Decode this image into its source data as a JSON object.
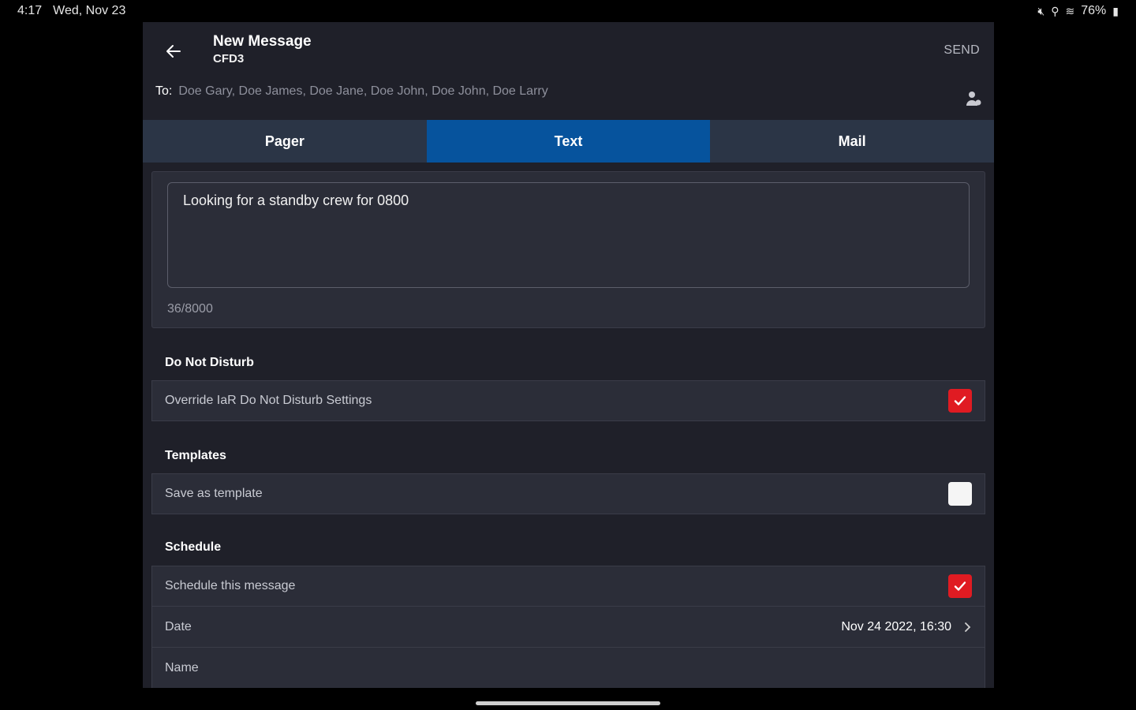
{
  "status_bar": {
    "time": "4:17",
    "date": "Wed, Nov 23",
    "icons": [
      "mute-icon",
      "location-icon",
      "wifi-icon"
    ],
    "battery": "76%"
  },
  "header": {
    "title": "New Message",
    "subtitle": "CFD3",
    "send_label": "SEND",
    "to_label": "To:",
    "recipients": "Doe Gary, Doe James, Doe Jane, Doe John, Doe John, Doe Larry"
  },
  "tabs": [
    {
      "label": "Pager",
      "active": false
    },
    {
      "label": "Text",
      "active": true
    },
    {
      "label": "Mail",
      "active": false
    }
  ],
  "compose": {
    "message": "Looking for a standby crew for 0800",
    "counter": "36/8000"
  },
  "dnd": {
    "section_title": "Do Not Disturb",
    "override_label": "Override IaR Do Not Disturb Settings",
    "override_checked": true
  },
  "templates": {
    "section_title": "Templates",
    "save_label": "Save as template",
    "save_checked": false
  },
  "schedule": {
    "section_title": "Schedule",
    "schedule_label": "Schedule this message",
    "schedule_checked": true,
    "date_label": "Date",
    "date_value": "Nov 24 2022, 16:30",
    "name_label": "Name"
  },
  "colors": {
    "accent_tab": "#06539d",
    "tab_bg": "#2b3546",
    "check_red": "#e01b22",
    "app_bg": "#1f2029",
    "card_bg": "#2b2d38"
  }
}
